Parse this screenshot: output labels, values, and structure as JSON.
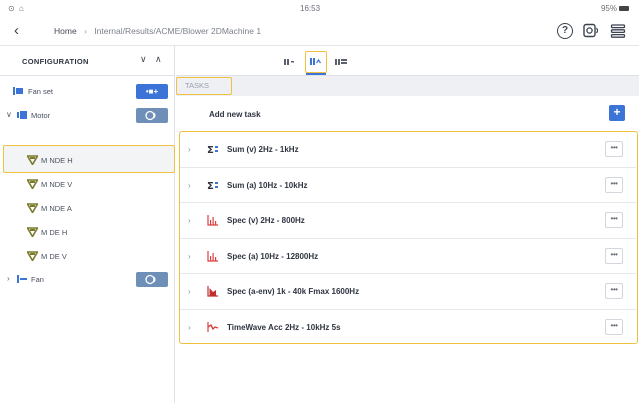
{
  "status_bar": {
    "left_icons": "⊙ ⌂",
    "time": "16:53",
    "battery": "95%"
  },
  "nav": {
    "back_icon": "‹",
    "breadcrumb": {
      "home": "Home",
      "separator": "›",
      "path": "Internal/Results/ACME/Blower 2DMachine 1"
    },
    "help_icon": "?"
  },
  "configuration": {
    "title": "CONFIGURATION",
    "collapse_icon": "∨",
    "expand_icon": "∧",
    "tree": [
      {
        "label": "Fan set",
        "expander": ""
      },
      {
        "label": "Motor",
        "expander": "∨"
      },
      {
        "label": "M NDE H",
        "expander": ""
      },
      {
        "label": "M NDE V",
        "expander": ""
      },
      {
        "label": "M NDE A",
        "expander": ""
      },
      {
        "label": "M DE H",
        "expander": ""
      },
      {
        "label": "M DE V",
        "expander": ""
      },
      {
        "label": "Fan",
        "expander": "›"
      }
    ],
    "add_group_button": "•■+"
  },
  "tasks": {
    "section_label": "TASKS",
    "add_new_label": "Add new task",
    "add_button": "+",
    "more_button": "•••",
    "chevron": "›",
    "items": [
      {
        "label": "Sum (v) 2Hz - 1kHz",
        "icon": "sum-icon"
      },
      {
        "label": "Sum (a) 10Hz - 10kHz",
        "icon": "sum-icon"
      },
      {
        "label": "Spec (v) 2Hz - 800Hz",
        "icon": "spectrum-icon"
      },
      {
        "label": "Spec (a) 10Hz - 12800Hz",
        "icon": "spectrum-icon"
      },
      {
        "label": "Spec (a-env) 1k - 40k  Fmax 1600Hz",
        "icon": "envelope-spectrum-icon"
      },
      {
        "label": "TimeWave Acc 2Hz - 10kHz 5s",
        "icon": "timewave-icon"
      }
    ]
  },
  "colors": {
    "accent": "#3b73d6",
    "highlight": "#f0c040",
    "sensor": "#7a7a2a",
    "spectrum": "#d94040"
  }
}
